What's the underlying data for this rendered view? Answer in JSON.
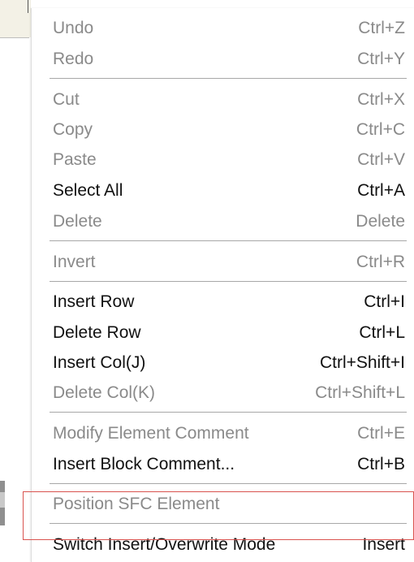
{
  "menu": {
    "items": [
      {
        "label": "Undo",
        "shortcut": "Ctrl+Z",
        "enabled": false
      },
      {
        "label": "Redo",
        "shortcut": "Ctrl+Y",
        "enabled": false
      },
      {
        "label": "Cut",
        "shortcut": "Ctrl+X",
        "enabled": false
      },
      {
        "label": "Copy",
        "shortcut": "Ctrl+C",
        "enabled": false
      },
      {
        "label": "Paste",
        "shortcut": "Ctrl+V",
        "enabled": false
      },
      {
        "label": "Select All",
        "shortcut": "Ctrl+A",
        "enabled": true
      },
      {
        "label": "Delete",
        "shortcut": "Delete",
        "enabled": false
      },
      {
        "label": "Invert",
        "shortcut": "Ctrl+R",
        "enabled": false
      },
      {
        "label": "Insert Row",
        "shortcut": "Ctrl+I",
        "enabled": true
      },
      {
        "label": "Delete Row",
        "shortcut": "Ctrl+L",
        "enabled": true
      },
      {
        "label": "Insert Col(J)",
        "shortcut": "Ctrl+Shift+I",
        "enabled": true
      },
      {
        "label": "Delete Col(K)",
        "shortcut": "Ctrl+Shift+L",
        "enabled": false
      },
      {
        "label": "Modify Element Comment",
        "shortcut": "Ctrl+E",
        "enabled": false
      },
      {
        "label": "Insert Block Comment...",
        "shortcut": "Ctrl+B",
        "enabled": true
      },
      {
        "label": "Position SFC Element",
        "shortcut": "",
        "enabled": false
      },
      {
        "label": "Switch Insert/Overwrite Mode",
        "shortcut": "Insert",
        "enabled": true
      }
    ]
  }
}
